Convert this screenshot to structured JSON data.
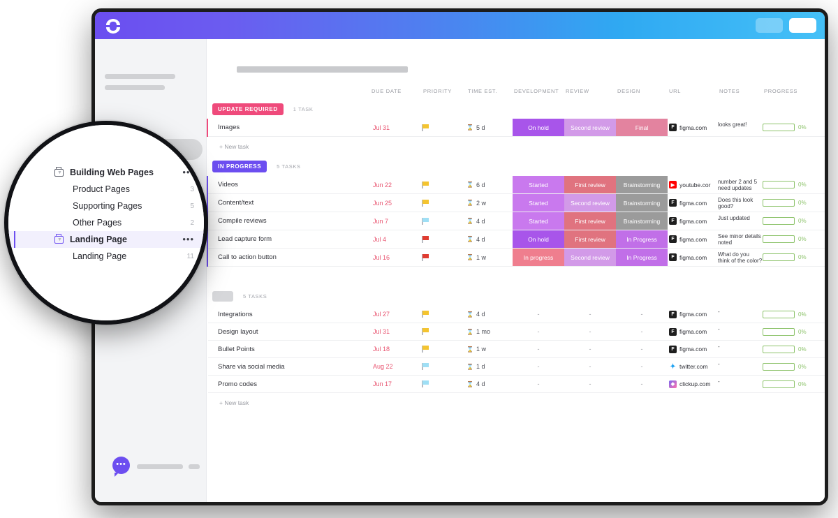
{
  "window": {
    "logo_name": "clickup-logo",
    "topbar_buttons": [
      "top-pill-1",
      "top-pill-2"
    ]
  },
  "sidebar": {
    "chat_dots": "•••"
  },
  "magnifier": {
    "items": [
      {
        "label": "Building Web Pages",
        "count": "",
        "menu": "•••",
        "type": "folder",
        "bold": true,
        "active": false,
        "child": false
      },
      {
        "label": "Product Pages",
        "count": "3",
        "menu": "",
        "type": "list",
        "bold": false,
        "active": false,
        "child": true
      },
      {
        "label": "Supporting Pages",
        "count": "5",
        "menu": "",
        "type": "list",
        "bold": false,
        "active": false,
        "child": true
      },
      {
        "label": "Other Pages",
        "count": "2",
        "menu": "",
        "type": "list",
        "bold": false,
        "active": false,
        "child": true
      },
      {
        "label": "Landing Page",
        "count": "",
        "menu": "•••",
        "type": "folder",
        "bold": true,
        "active": true,
        "child": false
      },
      {
        "label": "Landing Page",
        "count": "11",
        "menu": "",
        "type": "list",
        "bold": false,
        "active": false,
        "child": true
      }
    ]
  },
  "table": {
    "columns": [
      {
        "key": "name",
        "label": ""
      },
      {
        "key": "due",
        "label": "DUE DATE"
      },
      {
        "key": "priority",
        "label": "PRIORITY"
      },
      {
        "key": "time",
        "label": "TIME EST."
      },
      {
        "key": "development",
        "label": "DEVELOPMENT"
      },
      {
        "key": "review",
        "label": "REVIEW"
      },
      {
        "key": "design",
        "label": "DESIGN"
      },
      {
        "key": "url",
        "label": "URL"
      },
      {
        "key": "notes",
        "label": "NOTES"
      },
      {
        "key": "progress",
        "label": "PROGRESS"
      }
    ],
    "new_task_label": "+ New task",
    "groups": [
      {
        "badge": "UPDATE REQUIRED",
        "badge_style": "update",
        "count": "1 TASK",
        "rows": [
          {
            "name": "Images",
            "due": "Jul 31",
            "priority_color": "#f4c430",
            "time": "5 d",
            "development": {
              "text": "On hold",
              "color": "#a855ea"
            },
            "review": {
              "text": "Second review",
              "color": "#d29ae8"
            },
            "design": {
              "text": "Final",
              "color": "#e3839f"
            },
            "url": {
              "text": "figma.com",
              "icon": "figma"
            },
            "notes": "looks great!",
            "progress": "0%"
          }
        ]
      },
      {
        "badge": "IN PROGRESS",
        "badge_style": "inprog",
        "count": "5 TASKS",
        "rows": [
          {
            "name": "Videos",
            "due": "Jun 22",
            "priority_color": "#f4c430",
            "time": "6 d",
            "development": {
              "text": "Started",
              "color": "#c979ee"
            },
            "review": {
              "text": "First review",
              "color": "#e0737f"
            },
            "design": {
              "text": "Brainstorming",
              "color": "#9b9b9b"
            },
            "url": {
              "text": "youtube.cor",
              "icon": "youtube"
            },
            "notes": "number 2 and 5 need updates",
            "progress": "0%"
          },
          {
            "name": "Content/text",
            "due": "Jun 25",
            "priority_color": "#f4c430",
            "time": "2 w",
            "development": {
              "text": "Started",
              "color": "#c979ee"
            },
            "review": {
              "text": "Second review",
              "color": "#d29ae8"
            },
            "design": {
              "text": "Brainstorming",
              "color": "#9b9b9b"
            },
            "url": {
              "text": "figma.com",
              "icon": "figma"
            },
            "notes": "Does this look good?",
            "progress": "0%"
          },
          {
            "name": "Compile reviews",
            "due": "Jun 7",
            "priority_color": "#9fdff5",
            "time": "4 d",
            "development": {
              "text": "Started",
              "color": "#c979ee"
            },
            "review": {
              "text": "First review",
              "color": "#e0737f"
            },
            "design": {
              "text": "Brainstorming",
              "color": "#9b9b9b"
            },
            "url": {
              "text": "figma.com",
              "icon": "figma"
            },
            "notes": "Just updated",
            "progress": "0%"
          },
          {
            "name": "Lead capture form",
            "due": "Jul 4",
            "priority_color": "#e03c31",
            "time": "4 d",
            "development": {
              "text": "On hold",
              "color": "#a855ea"
            },
            "review": {
              "text": "First review",
              "color": "#e0737f"
            },
            "design": {
              "text": "In Progress",
              "color": "#c16fe8"
            },
            "url": {
              "text": "figma.com",
              "icon": "figma"
            },
            "notes": "See minor details noted",
            "progress": "0%"
          },
          {
            "name": "Call to action button",
            "due": "Jul 16",
            "priority_color": "#e03c31",
            "time": "1 w",
            "development": {
              "text": "In progress",
              "color": "#ef7e8e"
            },
            "review": {
              "text": "Second review",
              "color": "#d29ae8"
            },
            "design": {
              "text": "In Progress",
              "color": "#c16fe8"
            },
            "url": {
              "text": "figma.com",
              "icon": "figma"
            },
            "notes": "What do you think of the color?",
            "progress": "0%"
          }
        ]
      },
      {
        "badge": "",
        "badge_style": "blank",
        "count": "5 TASKS",
        "rows": [
          {
            "name": "Integrations",
            "due": "Jul 27",
            "priority_color": "#f4c430",
            "time": "4 d",
            "development": {
              "text": "-",
              "color": ""
            },
            "review": {
              "text": "-",
              "color": ""
            },
            "design": {
              "text": "-",
              "color": ""
            },
            "url": {
              "text": "figma.com",
              "icon": "figma"
            },
            "notes": "-",
            "progress": "0%"
          },
          {
            "name": "Design layout",
            "due": "Jul 31",
            "priority_color": "#f4c430",
            "time": "1 mo",
            "development": {
              "text": "-",
              "color": ""
            },
            "review": {
              "text": "-",
              "color": ""
            },
            "design": {
              "text": "-",
              "color": ""
            },
            "url": {
              "text": "figma.com",
              "icon": "figma"
            },
            "notes": "-",
            "progress": "0%"
          },
          {
            "name": "Bullet Points",
            "due": "Jul 18",
            "priority_color": "#f4c430",
            "time": "1 w",
            "development": {
              "text": "-",
              "color": ""
            },
            "review": {
              "text": "-",
              "color": ""
            },
            "design": {
              "text": "-",
              "color": ""
            },
            "url": {
              "text": "figma.com",
              "icon": "figma"
            },
            "notes": "-",
            "progress": "0%"
          },
          {
            "name": "Share via social media",
            "due": "Aug 22",
            "priority_color": "#9fdff5",
            "time": "1 d",
            "development": {
              "text": "-",
              "color": ""
            },
            "review": {
              "text": "-",
              "color": ""
            },
            "design": {
              "text": "-",
              "color": ""
            },
            "url": {
              "text": "twitter.com",
              "icon": "twitter"
            },
            "notes": "-",
            "progress": "0%"
          },
          {
            "name": "Promo codes",
            "due": "Jun 17",
            "priority_color": "#9fdff5",
            "time": "4 d",
            "development": {
              "text": "-",
              "color": ""
            },
            "review": {
              "text": "-",
              "color": ""
            },
            "design": {
              "text": "-",
              "color": ""
            },
            "url": {
              "text": "clickup.com",
              "icon": "clickup"
            },
            "notes": "-",
            "progress": "0%"
          }
        ]
      }
    ]
  }
}
